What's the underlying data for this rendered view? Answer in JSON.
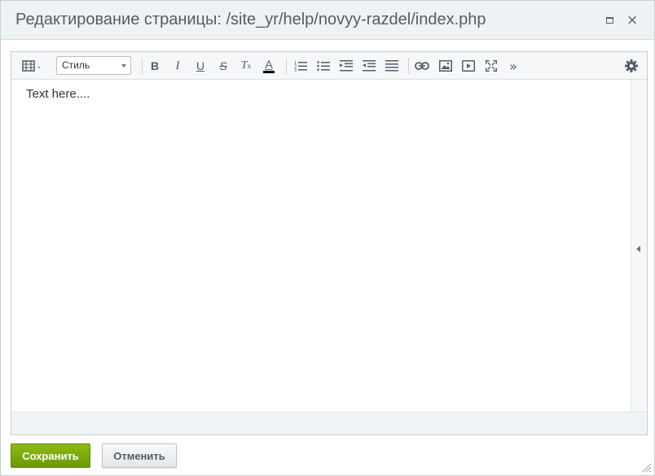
{
  "window": {
    "title": "Редактирование страницы: /site_yr/help/novyy-razdel/index.php",
    "maximize_icon": "maximize-icon",
    "close_icon": "close-icon",
    "close_glyph": "×"
  },
  "toolbar": {
    "style_select_value": "Стиль",
    "bold": "B",
    "italic": "I",
    "underline": "U",
    "strike": "S",
    "remove_format": "T",
    "font_color": "A",
    "more": "»"
  },
  "editor": {
    "content": "Text here...."
  },
  "footer": {
    "save_label": "Сохранить",
    "cancel_label": "Отменить"
  },
  "colors": {
    "accent_green": "#7aab09",
    "title_text": "#535c69"
  }
}
